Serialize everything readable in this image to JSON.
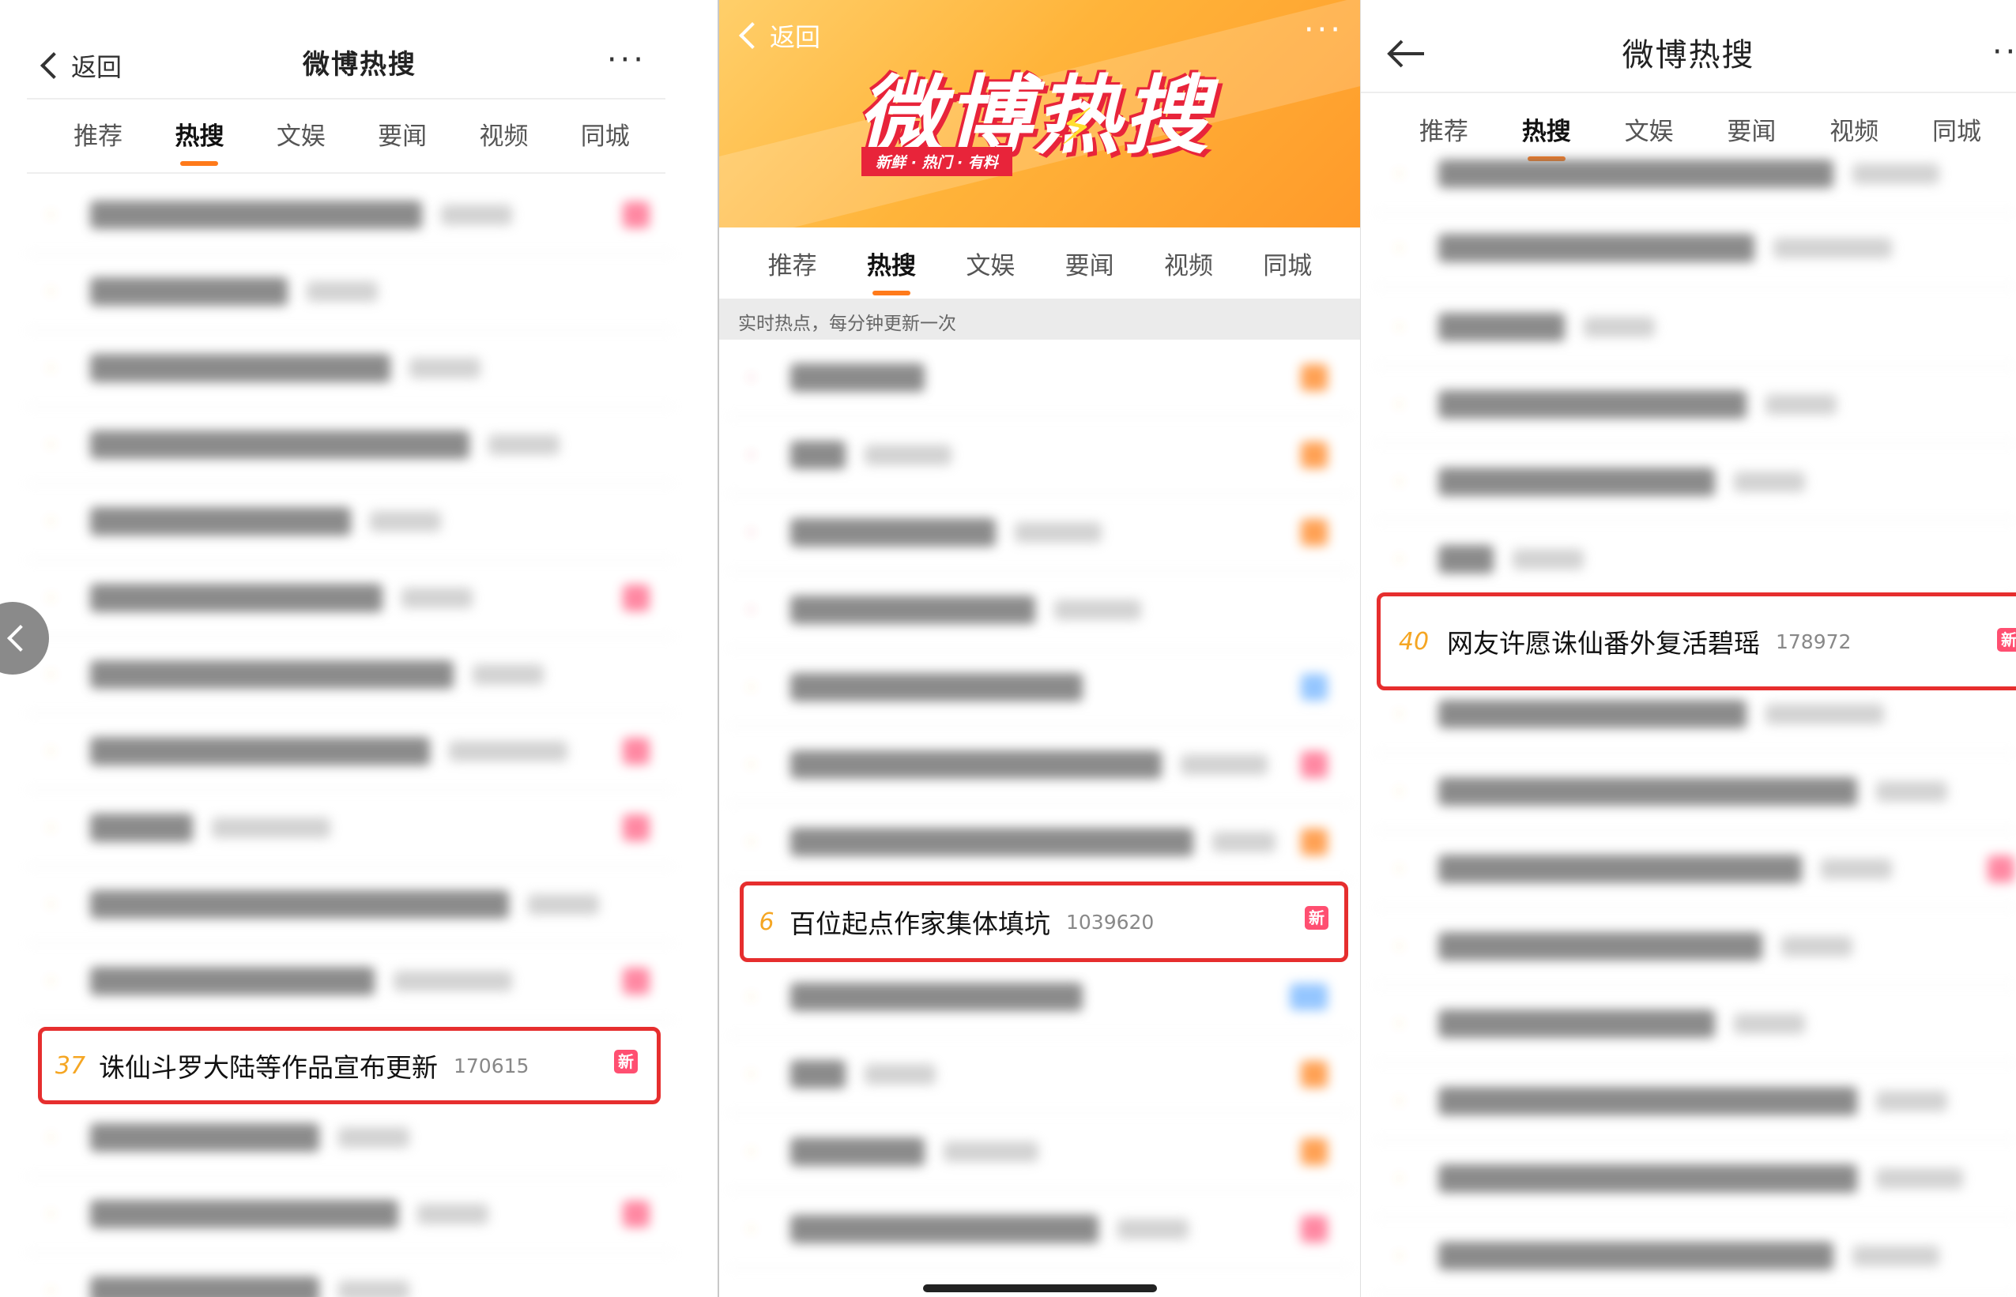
{
  "panel1": {
    "back_label": "返回",
    "title": "微博热搜",
    "more": "···",
    "tabs": [
      "推荐",
      "热搜",
      "文娱",
      "要闻",
      "视频",
      "同城"
    ],
    "highlight": {
      "rank": "37",
      "topic": "诛仙斗罗大陆等作品宣布更新",
      "count": "170615",
      "badge": "新"
    }
  },
  "panel2": {
    "back_label": "返回",
    "more": "···",
    "banner_title": "微博热搜",
    "banner_slogan": "新鲜 · 热门 · 有料",
    "tabs": [
      "推荐",
      "热搜",
      "文娱",
      "要闻",
      "视频",
      "同城"
    ],
    "subheader": "实时热点，每分钟更新一次",
    "highlight": {
      "rank": "6",
      "topic": "百位起点作家集体填坑",
      "count": "1039620",
      "badge": "新"
    }
  },
  "panel3": {
    "title": "微博热搜",
    "more": "···",
    "tabs": [
      "推荐",
      "热搜",
      "文娱",
      "要闻",
      "视频",
      "同城"
    ],
    "highlight": {
      "rank": "40",
      "topic": "网友许愿诛仙番外复活碧瑶",
      "count": "178972",
      "badge": "新"
    }
  },
  "colors": {
    "accent": "#ff7a1a",
    "highlight_border": "#e62e2e",
    "rank": "#f5a623",
    "new_badge": "#ff4f71"
  }
}
